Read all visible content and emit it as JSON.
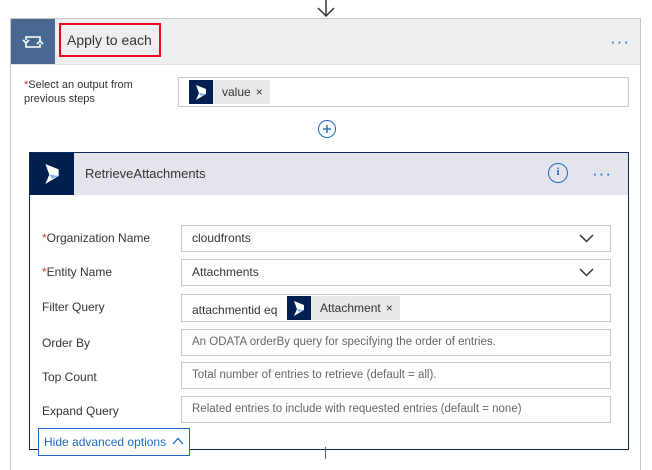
{
  "loop": {
    "title": "Apply to each",
    "more_label": "···",
    "select_label": "Select an output from previous steps",
    "required_mark": "*",
    "select_token": "value",
    "token_remove": "×"
  },
  "action": {
    "title": "RetrieveAttachments",
    "info_label": "i",
    "more_label": "···",
    "fields": {
      "org_label": "Organization Name",
      "org_value": "cloudfronts",
      "entity_label": "Entity Name",
      "entity_value": "Attachments",
      "filter_label": "Filter Query",
      "filter_prefix": "attachmentid eq",
      "filter_token": "Attachment",
      "order_label": "Order By",
      "order_placeholder": "An ODATA orderBy query for specifying the order of entries.",
      "top_label": "Top Count",
      "top_placeholder": "Total number of entries to retrieve (default = all).",
      "expand_label": "Expand Query",
      "expand_placeholder": "Related entries to include with requested entries (default = none)"
    },
    "hide_advanced": "Hide advanced options"
  },
  "colors": {
    "accent": "#1e6bc1",
    "loop_tile": "#486991",
    "dynamics_tile": "#002050",
    "highlight": "#e8001c"
  },
  "icons": [
    "arrow-down-icon",
    "loop-icon",
    "dynamics-365-icon",
    "add-icon",
    "info-icon",
    "chevron-down-icon",
    "chevron-up-icon",
    "close-icon"
  ]
}
